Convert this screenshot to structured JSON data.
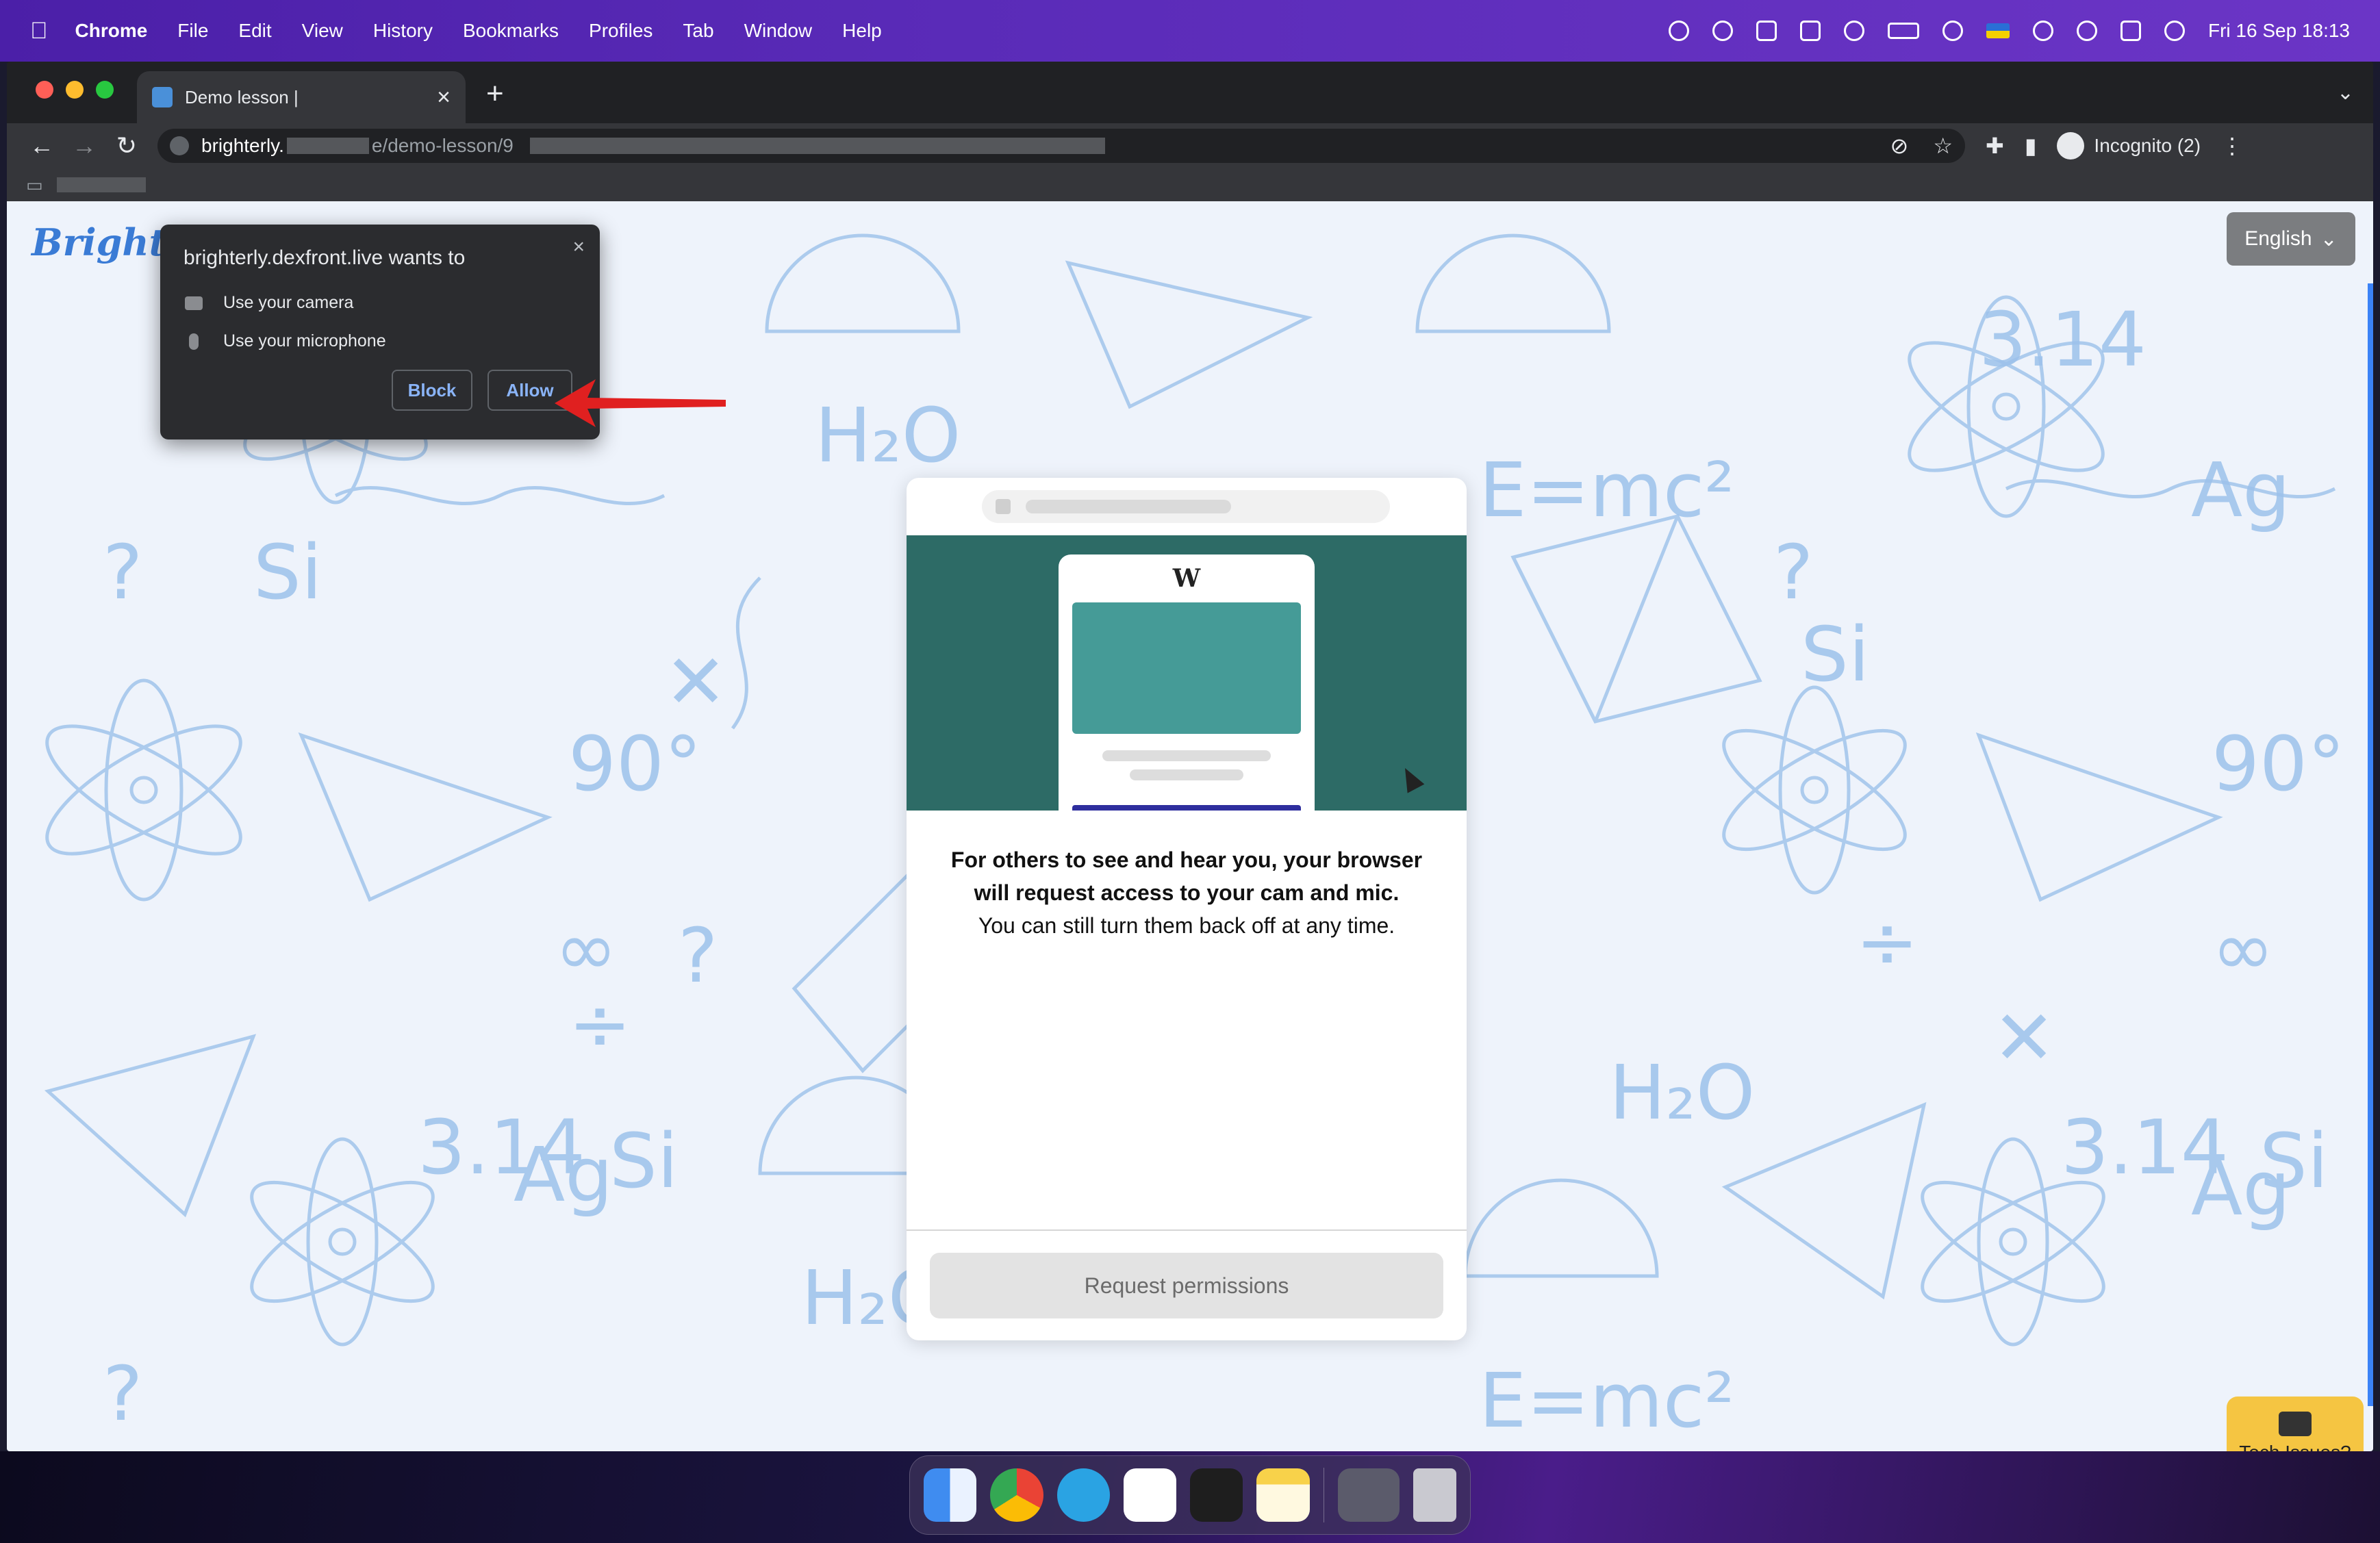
{
  "menubar": {
    "app": "Chrome",
    "items": [
      "File",
      "Edit",
      "View",
      "History",
      "Bookmarks",
      "Profiles",
      "Tab",
      "Window",
      "Help"
    ],
    "datetime": "Fri 16 Sep  18:13"
  },
  "browser": {
    "tab_title": "Demo lesson |",
    "url_host": "brighterly.",
    "url_path": "e/demo-lesson/9",
    "profile": "Incognito (2)"
  },
  "page": {
    "logo": "Brighterly",
    "language": "English",
    "card": {
      "line1": "For others to see and hear you, your browser",
      "line2": "will request access to your cam and mic.",
      "line3": "You can still turn them back off at any time.",
      "button": "Request permissions"
    },
    "tech_issues": "Tech Issues?"
  },
  "permission_prompt": {
    "title": "brighterly.dexfront.live wants to",
    "camera": "Use your camera",
    "microphone": "Use your microphone",
    "block": "Block",
    "allow": "Allow"
  },
  "icons": [
    "apple-icon",
    "back-icon",
    "forward-icon",
    "reload-icon",
    "lock-icon",
    "star-icon",
    "extensions-icon",
    "sidepanel-icon",
    "menu-icon",
    "camera-icon",
    "microphone-icon",
    "chat-icon"
  ],
  "colors": {
    "menubar": "#5a2bb8",
    "accent": "#8ab4f8",
    "card_illus": "#2d6b66",
    "tech_button": "#f5c542",
    "arrow": "#e02020"
  }
}
